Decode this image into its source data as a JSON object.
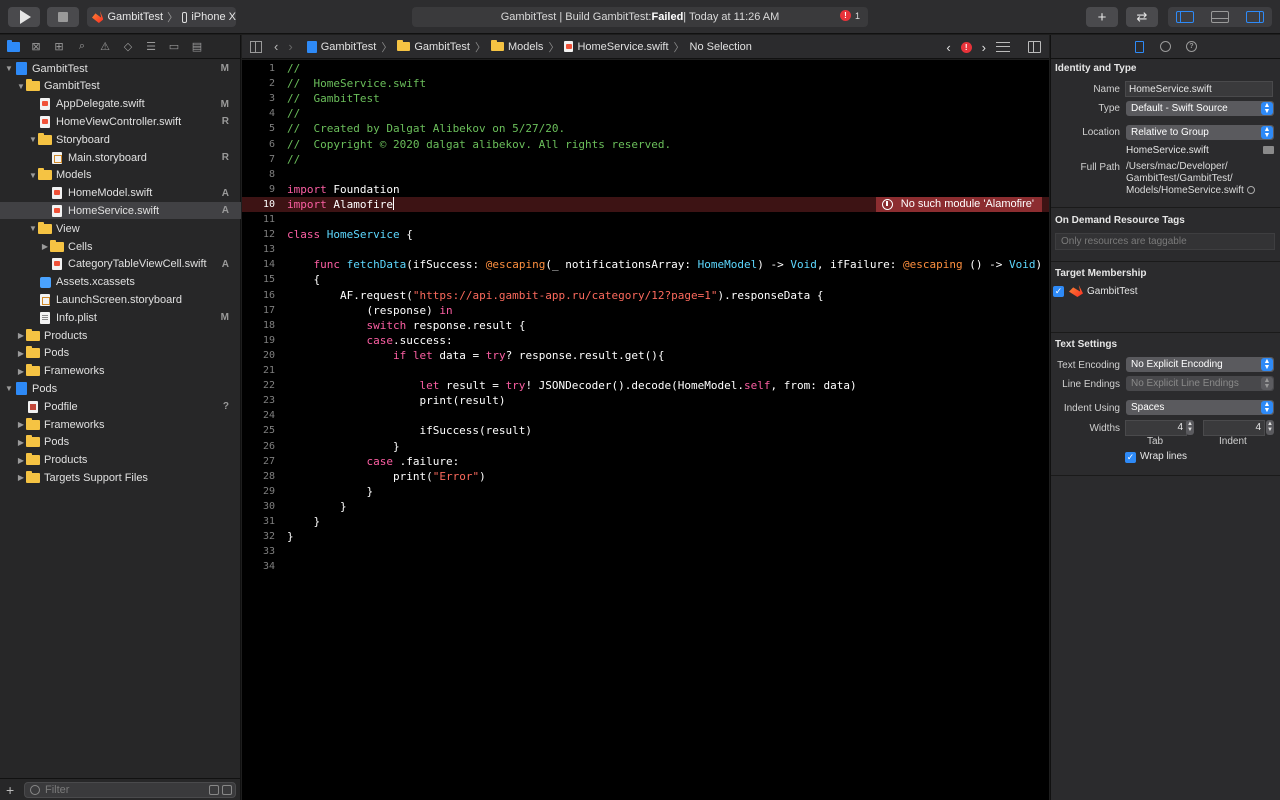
{
  "toolbar": {
    "scheme_name": "GambitTest",
    "device": "iPhone X",
    "activity_prefix": "GambitTest | Build GambitTest: ",
    "activity_status": "Failed",
    "activity_suffix": " | Today at 11:26 AM",
    "error_count": "1",
    "add_glyph": "+",
    "swap_glyph": "⇄"
  },
  "navigator": {
    "filter_placeholder": "Filter",
    "items": [
      {
        "label": "GambitTest",
        "badge": "M",
        "indent": 0,
        "kind": "project",
        "disclosure": "▼"
      },
      {
        "label": "GambitTest",
        "badge": "",
        "indent": 1,
        "kind": "folder",
        "disclosure": "▼"
      },
      {
        "label": "AppDelegate.swift",
        "badge": "M",
        "indent": 2,
        "kind": "swift",
        "disclosure": ""
      },
      {
        "label": "HomeViewController.swift",
        "badge": "R",
        "indent": 2,
        "kind": "swift",
        "disclosure": ""
      },
      {
        "label": "Storyboard",
        "badge": "",
        "indent": 2,
        "kind": "folder",
        "disclosure": "▼"
      },
      {
        "label": "Main.storyboard",
        "badge": "R",
        "indent": 3,
        "kind": "storyboard",
        "disclosure": ""
      },
      {
        "label": "Models",
        "badge": "",
        "indent": 2,
        "kind": "folder",
        "disclosure": "▼"
      },
      {
        "label": "HomeModel.swift",
        "badge": "A",
        "indent": 3,
        "kind": "swift",
        "disclosure": ""
      },
      {
        "label": "HomeService.swift",
        "badge": "A",
        "indent": 3,
        "kind": "swift",
        "disclosure": "",
        "selected": true
      },
      {
        "label": "View",
        "badge": "",
        "indent": 2,
        "kind": "folder",
        "disclosure": "▼"
      },
      {
        "label": "Cells",
        "badge": "",
        "indent": 3,
        "kind": "folder",
        "disclosure": "▶"
      },
      {
        "label": "CategoryTableViewCell.swift",
        "badge": "A",
        "indent": 3,
        "kind": "swift",
        "disclosure": ""
      },
      {
        "label": "Assets.xcassets",
        "badge": "",
        "indent": 2,
        "kind": "assets",
        "disclosure": ""
      },
      {
        "label": "LaunchScreen.storyboard",
        "badge": "",
        "indent": 2,
        "kind": "storyboard",
        "disclosure": ""
      },
      {
        "label": "Info.plist",
        "badge": "M",
        "indent": 2,
        "kind": "plist",
        "disclosure": ""
      },
      {
        "label": "Products",
        "badge": "",
        "indent": 1,
        "kind": "folder",
        "disclosure": "▶"
      },
      {
        "label": "Pods",
        "badge": "",
        "indent": 1,
        "kind": "folder",
        "disclosure": "▶"
      },
      {
        "label": "Frameworks",
        "badge": "",
        "indent": 1,
        "kind": "folder",
        "disclosure": "▶"
      },
      {
        "label": "Pods",
        "badge": "",
        "indent": 0,
        "kind": "project",
        "disclosure": "▼"
      },
      {
        "label": "Podfile",
        "badge": "?",
        "indent": 1,
        "kind": "podfile",
        "disclosure": ""
      },
      {
        "label": "Frameworks",
        "badge": "",
        "indent": 1,
        "kind": "folder",
        "disclosure": "▶"
      },
      {
        "label": "Pods",
        "badge": "",
        "indent": 1,
        "kind": "folder",
        "disclosure": "▶"
      },
      {
        "label": "Products",
        "badge": "",
        "indent": 1,
        "kind": "folder",
        "disclosure": "▶"
      },
      {
        "label": "Targets Support Files",
        "badge": "",
        "indent": 1,
        "kind": "folder",
        "disclosure": "▶"
      }
    ]
  },
  "jumpbar": {
    "crumbs": [
      {
        "label": "GambitTest",
        "kind": "project"
      },
      {
        "label": "GambitTest",
        "kind": "folder"
      },
      {
        "label": "Models",
        "kind": "folder"
      },
      {
        "label": "HomeService.swift",
        "kind": "swift"
      },
      {
        "label": "No Selection",
        "kind": "none"
      }
    ]
  },
  "editor": {
    "error_line": 10,
    "error_message": "No such module 'Alamofire'",
    "lines": [
      [
        [
          "c",
          "//"
        ]
      ],
      [
        [
          "c",
          "//  HomeService.swift"
        ]
      ],
      [
        [
          "c",
          "//  GambitTest"
        ]
      ],
      [
        [
          "c",
          "//"
        ]
      ],
      [
        [
          "c",
          "//  Created by Dalgat Alibekov on 5/27/20."
        ]
      ],
      [
        [
          "c",
          "//  Copyright © 2020 dalgat alibekov. All rights reserved."
        ]
      ],
      [
        [
          "c",
          "//"
        ]
      ],
      [],
      [
        [
          "k",
          "import"
        ],
        [
          "p",
          " Foundation"
        ]
      ],
      [
        [
          "k",
          "import"
        ],
        [
          "p",
          " Alamofire"
        ]
      ],
      [],
      [
        [
          "k",
          "class"
        ],
        [
          "p",
          " "
        ],
        [
          "t",
          "HomeService"
        ],
        [
          "p",
          " {"
        ]
      ],
      [],
      [
        [
          "p",
          "    "
        ],
        [
          "k",
          "func"
        ],
        [
          "p",
          " "
        ],
        [
          "t",
          "fetchData"
        ],
        [
          "p",
          "(ifSuccess: "
        ],
        [
          "a",
          "@escaping"
        ],
        [
          "p",
          "(_ notificationsArray: "
        ],
        [
          "t",
          "HomeModel"
        ],
        [
          "p",
          ") -> "
        ],
        [
          "t",
          "Void"
        ],
        [
          "p",
          ", ifFailure: "
        ],
        [
          "a",
          "@escaping"
        ],
        [
          "p",
          " () -> "
        ],
        [
          "t",
          "Void"
        ],
        [
          "p",
          ")"
        ]
      ],
      [
        [
          "p",
          "    {"
        ]
      ],
      [
        [
          "p",
          "        AF.request("
        ],
        [
          "s",
          "\"https://api.gambit-app.ru/category/12?page=1\""
        ],
        [
          "p",
          ").responseData {"
        ]
      ],
      [
        [
          "p",
          "            (response) "
        ],
        [
          "k",
          "in"
        ]
      ],
      [
        [
          "p",
          "            "
        ],
        [
          "k",
          "switch"
        ],
        [
          "p",
          " response.result {"
        ]
      ],
      [
        [
          "p",
          "            "
        ],
        [
          "k",
          "case"
        ],
        [
          "p",
          ".success:"
        ]
      ],
      [
        [
          "p",
          "                "
        ],
        [
          "k",
          "if"
        ],
        [
          "p",
          " "
        ],
        [
          "k",
          "let"
        ],
        [
          "p",
          " data = "
        ],
        [
          "k",
          "try"
        ],
        [
          "p",
          "? response.result.get(){"
        ]
      ],
      [],
      [
        [
          "p",
          "                    "
        ],
        [
          "k",
          "let"
        ],
        [
          "p",
          " result = "
        ],
        [
          "k",
          "try"
        ],
        [
          "p",
          "! JSONDecoder().decode(HomeModel."
        ],
        [
          "k",
          "self"
        ],
        [
          "p",
          ", from: data)"
        ]
      ],
      [
        [
          "p",
          "                    print(result)"
        ]
      ],
      [],
      [
        [
          "p",
          "                    ifSuccess(result)"
        ]
      ],
      [
        [
          "p",
          "                }"
        ]
      ],
      [
        [
          "p",
          "            "
        ],
        [
          "k",
          "case"
        ],
        [
          "p",
          " .failure:"
        ]
      ],
      [
        [
          "p",
          "                print("
        ],
        [
          "s",
          "\"Error\""
        ],
        [
          "p",
          ")"
        ]
      ],
      [
        [
          "p",
          "            }"
        ]
      ],
      [
        [
          "p",
          "        }"
        ]
      ],
      [
        [
          "p",
          "    }"
        ]
      ],
      [
        [
          "p",
          "}"
        ]
      ],
      [],
      []
    ]
  },
  "inspector": {
    "identity_title": "Identity and Type",
    "name_label": "Name",
    "name_value": "HomeService.swift",
    "type_label": "Type",
    "type_value": "Default - Swift Source",
    "location_label": "Location",
    "location_value": "Relative to Group",
    "location_file": "HomeService.swift",
    "full_path_label": "Full Path",
    "full_path_lines": [
      "/Users/mac/Developer/",
      "GambitTest/GambitTest/",
      "Models/HomeService.swift"
    ],
    "odr_title": "On Demand Resource Tags",
    "odr_placeholder": "Only resources are taggable",
    "target_title": "Target Membership",
    "target_name": "GambitTest",
    "text_title": "Text Settings",
    "encoding_label": "Text Encoding",
    "encoding_value": "No Explicit Encoding",
    "endings_label": "Line Endings",
    "endings_value": "No Explicit Line Endings",
    "indent_using_label": "Indent Using",
    "indent_using_value": "Spaces",
    "widths_label": "Widths",
    "tab_value": "4",
    "indent_value": "4",
    "tab_label": "Tab",
    "indent_label": "Indent",
    "wrap_label": "Wrap lines"
  },
  "colors": {
    "accent": "#2e8af7",
    "error": "#e8333a",
    "folder": "#f5c343",
    "keyword": "#fc5fa3",
    "comment": "#6bbf5b",
    "string": "#fc6a5d",
    "type": "#5dd8ff"
  }
}
